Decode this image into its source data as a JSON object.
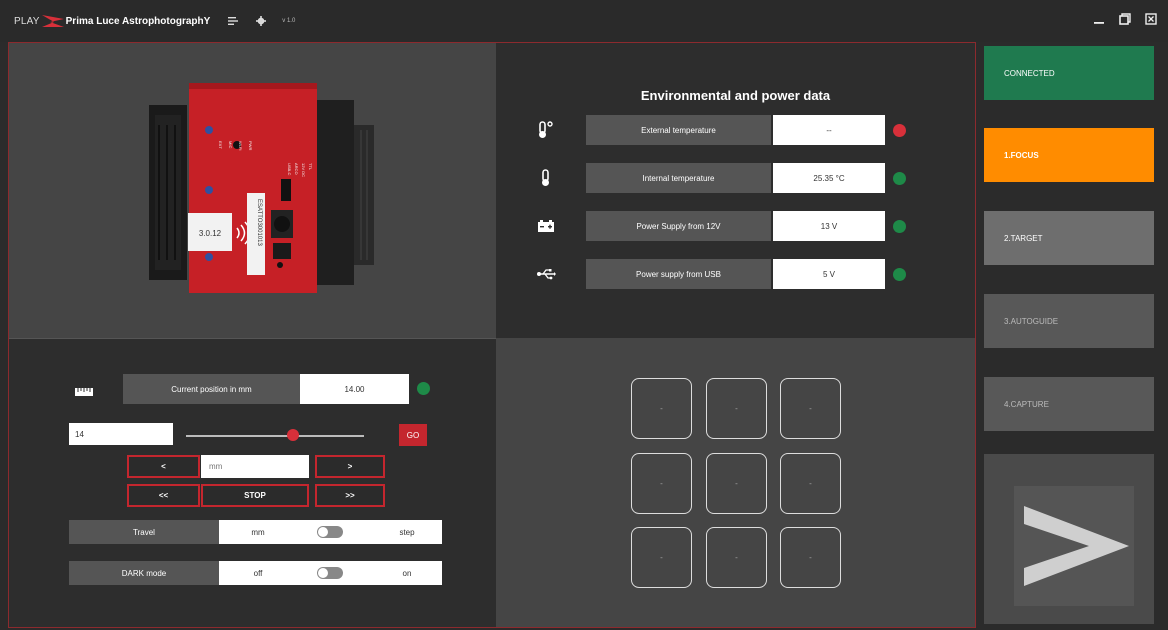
{
  "titlebar": {
    "play_label": "PLAY",
    "app_name": "Prima Luce AstrophotographY",
    "version": "v 1.0"
  },
  "device": {
    "label_left": "3.0.12",
    "label_serial": "ESATTO3001013",
    "port_labels": [
      "USB-C",
      "ARCO",
      "12V DC",
      "TTL",
      "PWR",
      "Wi-Fi",
      "MIC",
      "EXT"
    ]
  },
  "environment": {
    "title": "Environmental and power data",
    "rows": [
      {
        "icon": "thermometer-degree-icon",
        "label": "External temperature",
        "value": "--",
        "status": "red"
      },
      {
        "icon": "thermometer-icon",
        "label": "Internal temperature",
        "value": "25.35 °C",
        "status": "green"
      },
      {
        "icon": "battery-icon",
        "label": "Power Supply from 12V",
        "value": "13 V",
        "status": "green"
      },
      {
        "icon": "usb-icon",
        "label": "Power supply from USB",
        "value": "5 V",
        "status": "green"
      }
    ]
  },
  "focuser": {
    "position_label": "Current position in mm",
    "position_value": "14.00",
    "target_input": "14",
    "slider_fraction": 0.6,
    "go_label": "GO",
    "step_back_label": "<",
    "step_fwd_label": ">",
    "fast_back_label": "<<",
    "fast_fwd_label": ">>",
    "stop_label": "STOP",
    "step_placeholder": "mm",
    "travel": {
      "label": "Travel",
      "left": "mm",
      "right": "step"
    },
    "dark_mode": {
      "label": "DARK mode",
      "left": "off",
      "right": "on"
    }
  },
  "grid": {
    "cells": [
      "-",
      "-",
      "-",
      "-",
      "-",
      "-",
      "-",
      "-",
      "-"
    ]
  },
  "sidebar": {
    "connected": "CONNECTED",
    "focus": "1.FOCUS",
    "target": "2.TARGET",
    "autoguide": "3.AUTOGUIDE",
    "capture": "4.CAPTURE"
  },
  "colors": {
    "accent_red": "#c4262e",
    "connected_green": "#1f7a4f",
    "active_orange": "#ff8c00",
    "led_green": "#1e8a48",
    "led_red": "#d8303a"
  }
}
